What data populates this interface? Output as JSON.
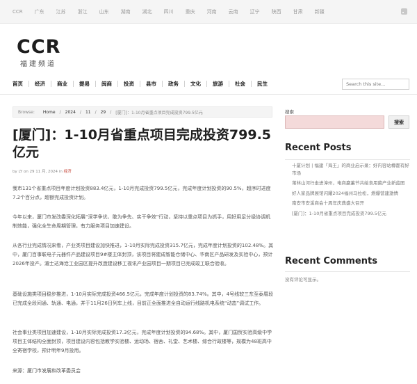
{
  "topbar": {
    "regions": [
      "CCR",
      "广东",
      "江苏",
      "浙江",
      "山东",
      "湖南",
      "湖北",
      "四川",
      "重庆",
      "河南",
      "云南",
      "辽宁",
      "陕西",
      "甘肃",
      "新疆"
    ],
    "rss_icon": "rss-icon"
  },
  "logo": {
    "main": "CCR",
    "sub": "福建频道"
  },
  "nav": {
    "items": [
      "首页",
      "经济",
      "商业",
      "提易",
      "闽商",
      "投资",
      "县市",
      "政务",
      "文化",
      "旅游",
      "社会",
      "民生"
    ],
    "search_placeholder": "Search this site..."
  },
  "breadcrumb": {
    "prefix": "Browse:",
    "home": "Home",
    "year": "2024",
    "month": "11",
    "day": "29",
    "current": "[厦门]：1-10月省重点项目完成投资799.5亿元"
  },
  "article": {
    "title": "[厦门]：1-10月省重点项目完成投资799.5亿元",
    "meta": {
      "by": "by",
      "author": "LY",
      "on": "on",
      "date": "29 11 月, 2024",
      "in": "in",
      "category": "经济"
    },
    "paragraphs": [
      "我市131个省重点项目年度计划投资883.4亿元，1-10月完成投资799.5亿元，完成年度计划投资的90.5%，超序时进度7.2个百分点，超额完成投资计划。",
      "今年以来，厦门市发改委深化拓展“深学争优、敢为争先、实干争效”行动，坚持以重点项目为抓手，用好用足分级协调机制效能，强化全生命周期管理，有力服务项目加速建设。",
      "从各行业完成情况来看，产业类项目建设加快推进，1-10月实际完成投资315.7亿元，完成年度计划投资的102.48%。其中，厦门百事联电子元器件产品建设项目9#楼主体封顶，该项目将建成智能仓储中心、华南区产品研发及实验中心，预计2026年投产。湄士达海沧工业园区提升改造建设移工视讯产业园项目一期项目已完成竣工联合验收。",
      "基础设施类项目稳步推进，1-10月实际完成投资466.5亿元，完成年度计划投资的83.74%。其中，4号线软三东至泰厝段已完成全段间通、轨通、电通，并于11月26日列车上线，目前正全面推进全自动运行线路机电系统“动态”调试工作。",
      "社会事业类项目加速建设，1-10月实际完成投资17.3亿元，完成年度计划投资的94.68%。其中，厦门国贸实验高级中学项目主体结构全面封顶，项目建设内容包括教学实验楼、运动场、宿舍、礼堂、艺术楼、综合行政楼等，规模为48班高中全寄宿学校，预计明年9月投用。"
    ],
    "source": "来源：厦门市发展和改革委员会"
  },
  "sidebar": {
    "search_label": "搜索",
    "search_button": "搜索",
    "recent_posts_heading": "Recent Posts",
    "recent_posts": [
      "十厦计划 | 福建「海王」的商业启示录：好内容站樽都有好市场",
      "莆林山河行走进漳州，电商赢蓄节共绘食用菌产业新蓝图",
      "好人家品牌展馆闪耀2024福州马拉松，燃爆营建激情",
      "南安市安溪商会十周年庆典盛大召开",
      "[厦门]：1-10月省重点项目完成投资799.5亿元"
    ],
    "recent_comments_heading": "Recent Comments",
    "no_comments": "没有评论可显示。"
  }
}
